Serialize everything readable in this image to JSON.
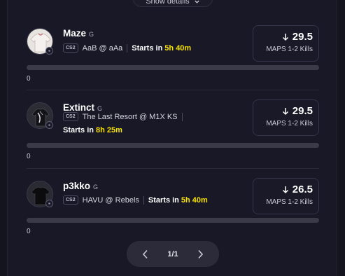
{
  "show_details": {
    "label": "Show details"
  },
  "picks": [
    {
      "player": "Maze",
      "position": "G",
      "game": "CS2",
      "matchup": "AaB @ aAa",
      "starts_label": "Starts in",
      "starts_time": "5h 40m",
      "line": "29.5",
      "direction": "arrow-down-icon",
      "stat": "MAPS 1-2 Kills",
      "progress": 0,
      "progress_label": "0",
      "avatar": "white-jersey-icon"
    },
    {
      "player": "Extinct",
      "position": "G",
      "game": "CS2",
      "matchup": "The Last Resort @ M1X KS",
      "starts_label": "Starts in",
      "starts_time": "8h 25m",
      "line": "29.5",
      "direction": "arrow-down-icon",
      "stat": "MAPS 1-2 Kills",
      "progress": 0,
      "progress_label": "0",
      "avatar": "black-jersey-icon"
    },
    {
      "player": "p3kko",
      "position": "G",
      "game": "CS2",
      "matchup": "HAVU @ Rebels",
      "starts_label": "Starts in",
      "starts_time": "5h 40m",
      "line": "26.5",
      "direction": "arrow-down-icon",
      "stat": "MAPS 1-2 Kills",
      "progress": 0,
      "progress_label": "0",
      "avatar": "black-tshirt-icon"
    }
  ],
  "pagination": {
    "label": "1/1",
    "current": 1,
    "total": 1
  },
  "colors": {
    "background": "#181826",
    "accent_yellow": "#f5e000",
    "track": "#3a3a48"
  }
}
